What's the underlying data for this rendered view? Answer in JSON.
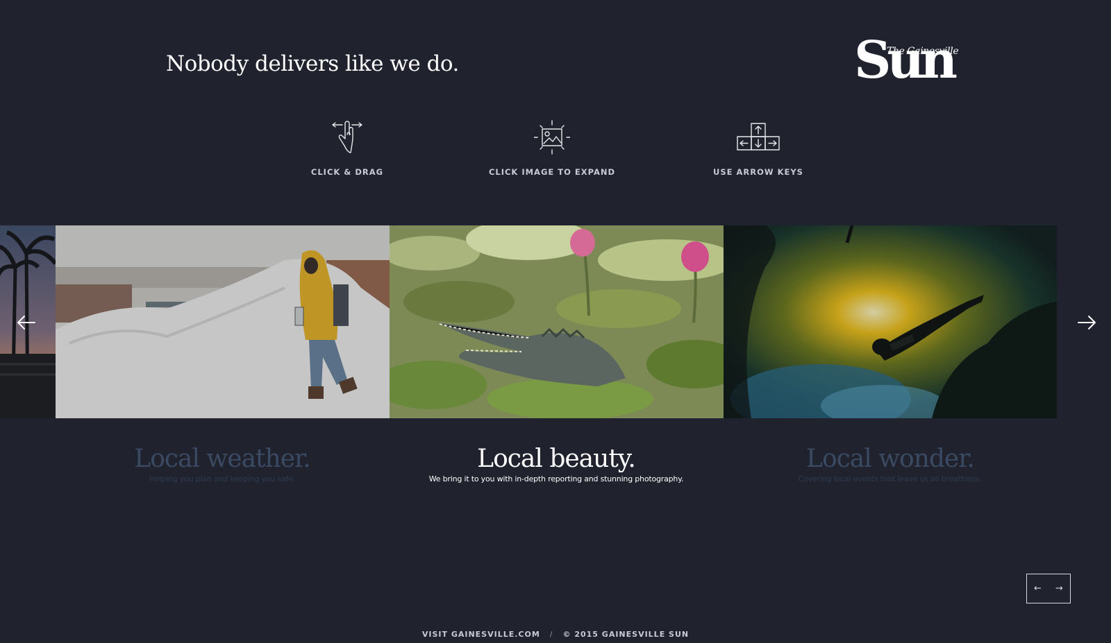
{
  "header": {
    "tagline": "Nobody delivers like we do.",
    "logo_the": "The Gainesville",
    "logo_sun": "Sun"
  },
  "hints": [
    {
      "icon": "hand-drag-icon",
      "label": "CLICK & DRAG"
    },
    {
      "icon": "image-expand-icon",
      "label": "CLICK IMAGE TO EXPAND"
    },
    {
      "icon": "arrow-keys-icon",
      "label": "USE ARROW KEYS"
    }
  ],
  "slides": [
    {
      "title": "Local weather.",
      "subtitle": "Helping you plan and keeping you safe.",
      "state": "dim",
      "photo": "man in yellow coat walking by snow pile"
    },
    {
      "title": "Local beauty.",
      "subtitle": "We bring it to you with in-depth reporting and stunning photography.",
      "state": "active",
      "photo": "alligator among lily pads and pink lotus"
    },
    {
      "title": "Local wonder.",
      "subtitle": "Covering local events that leave us all breathless.",
      "state": "dim",
      "photo": "diver swimming in spring toward sunlight"
    }
  ],
  "nav": {
    "prev": "←",
    "next": "→"
  },
  "footer": {
    "link": "VISIT GAINESVILLE.COM",
    "separator": "/",
    "copyright": "© 2015 GAINESVILLE SUN"
  },
  "colors": {
    "background": "#20232e",
    "dim_title": "#3b4a63",
    "text": "#ffffff"
  }
}
